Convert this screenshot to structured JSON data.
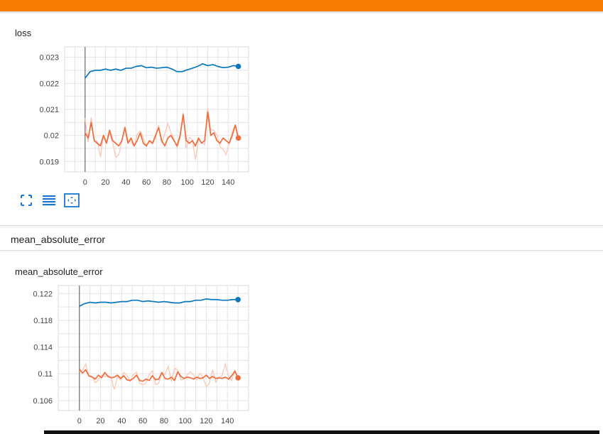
{
  "cards": [
    {
      "title": "loss",
      "controls": [
        {
          "icon": "fullscreen-icon"
        },
        {
          "icon": "data-table-icon"
        },
        {
          "icon": "fit-domain-icon"
        }
      ]
    },
    {
      "group_title": "mean_absolute_error",
      "title": "mean_absolute_error"
    }
  ],
  "colors": {
    "topbar": "#f57c00",
    "train": "#0877bd",
    "validation": "#f26b3b",
    "validation_raw": "#fbc8b5",
    "grid": "#e5e5e5"
  },
  "chart_data": [
    {
      "type": "line",
      "title": "loss",
      "xlim": [
        -20,
        160
      ],
      "ylim": [
        0.0186,
        0.0234
      ],
      "xticks": [
        0,
        20,
        40,
        60,
        80,
        100,
        120,
        140
      ],
      "yticks": [
        0.019,
        0.02,
        0.021,
        0.022,
        0.023
      ],
      "ytick_labels": [
        "0.019",
        "0.02",
        "0.021",
        "0.022",
        "0.023"
      ],
      "grid": true,
      "series": [
        {
          "color": "#0877bd",
          "x": [
            0,
            5,
            10,
            15,
            20,
            25,
            30,
            35,
            40,
            45,
            50,
            55,
            60,
            65,
            70,
            75,
            80,
            85,
            90,
            95,
            100,
            105,
            110,
            115,
            120,
            125,
            130,
            135,
            140,
            145,
            150
          ],
          "y": [
            0.0222,
            0.02245,
            0.0225,
            0.0225,
            0.02255,
            0.0225,
            0.02255,
            0.0225,
            0.02258,
            0.02258,
            0.02265,
            0.02268,
            0.0226,
            0.02262,
            0.02258,
            0.0226,
            0.02262,
            0.02255,
            0.02245,
            0.02245,
            0.02252,
            0.02258,
            0.02265,
            0.02275,
            0.02268,
            0.02272,
            0.02265,
            0.0226,
            0.02262,
            0.02268,
            0.02265
          ]
        },
        {
          "color": "#f26b3b",
          "x": [
            0,
            3,
            6,
            9,
            12,
            15,
            18,
            21,
            24,
            27,
            30,
            33,
            36,
            39,
            42,
            45,
            48,
            51,
            54,
            57,
            60,
            63,
            66,
            69,
            72,
            75,
            78,
            81,
            84,
            87,
            90,
            93,
            96,
            99,
            102,
            105,
            108,
            111,
            114,
            117,
            120,
            123,
            126,
            129,
            132,
            135,
            138,
            141,
            144,
            147,
            150
          ],
          "y": [
            0.0201,
            0.0199,
            0.0205,
            0.0198,
            0.0197,
            0.0196,
            0.02,
            0.0197,
            0.0202,
            0.0198,
            0.0197,
            0.0196,
            0.0198,
            0.0203,
            0.0197,
            0.0199,
            0.0196,
            0.0198,
            0.0201,
            0.0197,
            0.0196,
            0.0198,
            0.0197,
            0.02,
            0.0203,
            0.0198,
            0.0196,
            0.0199,
            0.02,
            0.0198,
            0.0196,
            0.02,
            0.0208,
            0.0198,
            0.0197,
            0.0198,
            0.0196,
            0.0199,
            0.0197,
            0.0198,
            0.0209,
            0.02,
            0.0201,
            0.0198,
            0.0197,
            0.0199,
            0.0198,
            0.0197,
            0.02,
            0.0204,
            0.0199
          ]
        }
      ]
    },
    {
      "type": "line",
      "title": "mean_absolute_error",
      "xlim": [
        -20,
        160
      ],
      "ylim": [
        0.1045,
        0.1232
      ],
      "xticks": [
        0,
        20,
        40,
        60,
        80,
        100,
        120,
        140
      ],
      "yticks": [
        0.106,
        0.11,
        0.114,
        0.118,
        0.122
      ],
      "ytick_labels": [
        "0.106",
        "0.11",
        "0.114",
        "0.118",
        "0.122"
      ],
      "grid": true,
      "series": [
        {
          "color": "#0877bd",
          "x": [
            0,
            5,
            10,
            15,
            20,
            25,
            30,
            35,
            40,
            45,
            50,
            55,
            60,
            65,
            70,
            75,
            80,
            85,
            90,
            95,
            100,
            105,
            110,
            115,
            120,
            125,
            130,
            135,
            140,
            145,
            150
          ],
          "y": [
            0.1201,
            0.1205,
            0.1207,
            0.1206,
            0.1207,
            0.1207,
            0.1206,
            0.1207,
            0.1208,
            0.1208,
            0.121,
            0.121,
            0.1208,
            0.1209,
            0.1208,
            0.1207,
            0.1208,
            0.1207,
            0.1206,
            0.1206,
            0.1208,
            0.1208,
            0.121,
            0.121,
            0.1212,
            0.1211,
            0.1211,
            0.121,
            0.121,
            0.1211,
            0.1211
          ]
        },
        {
          "color": "#f26b3b",
          "x": [
            0,
            3,
            6,
            9,
            12,
            15,
            18,
            21,
            24,
            27,
            30,
            33,
            36,
            39,
            42,
            45,
            48,
            51,
            54,
            57,
            60,
            63,
            66,
            69,
            72,
            75,
            78,
            81,
            84,
            87,
            90,
            93,
            96,
            99,
            102,
            105,
            108,
            111,
            114,
            117,
            120,
            123,
            126,
            129,
            132,
            135,
            138,
            141,
            144,
            147,
            150
          ],
          "y": [
            0.1107,
            0.1101,
            0.1106,
            0.1097,
            0.1095,
            0.1092,
            0.1098,
            0.1094,
            0.1102,
            0.1096,
            0.1094,
            0.1095,
            0.1098,
            0.1093,
            0.1097,
            0.1091,
            0.109,
            0.1093,
            0.1098,
            0.109,
            0.1089,
            0.1092,
            0.109,
            0.1097,
            0.1091,
            0.1092,
            0.1102,
            0.1093,
            0.1092,
            0.1095,
            0.109,
            0.1103,
            0.1096,
            0.1093,
            0.1095,
            0.1094,
            0.1092,
            0.1095,
            0.1093,
            0.1094,
            0.1098,
            0.1093,
            0.1096,
            0.1093,
            0.1094,
            0.1093,
            0.1095,
            0.1092,
            0.1097,
            0.1104,
            0.1094
          ]
        }
      ]
    }
  ]
}
